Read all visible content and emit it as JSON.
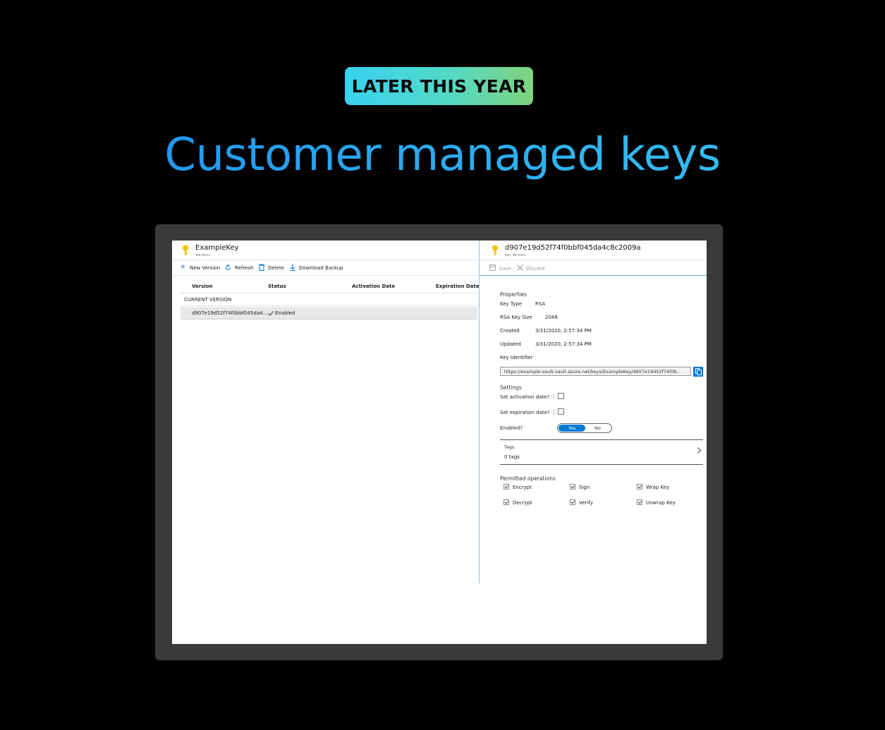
{
  "badge": "LATER THIS YEAR",
  "headline": "Customer managed keys",
  "colors": {
    "accent": "#0078d4",
    "key_icon": "#f5c400",
    "headline_start": "#1e8ef0",
    "headline_end": "#38c7f2"
  },
  "left_blade": {
    "title": "ExampleKey",
    "subtitle": "Versions",
    "icon": "key-icon",
    "toolbar": [
      {
        "icon": "plus-icon",
        "label": "New Version"
      },
      {
        "icon": "refresh-icon",
        "label": "Refresh"
      },
      {
        "icon": "trash-icon",
        "label": "Delete"
      },
      {
        "icon": "download-icon",
        "label": "Download Backup"
      }
    ],
    "columns": [
      "Version",
      "Status",
      "Activation Date",
      "Expiration Date"
    ],
    "group_label": "CURRENT VERSION",
    "rows": [
      {
        "version": "d907e19d52f74f0bbf045da4...",
        "status": "Enabled",
        "activation": "",
        "expiration": ""
      }
    ]
  },
  "right_blade": {
    "title": "d907e19d52f74f0bbf045da4c8c2009a",
    "subtitle": "Key Version",
    "icon": "key-icon",
    "toolbar": [
      {
        "icon": "save-icon",
        "label": "Save"
      },
      {
        "icon": "close-icon",
        "label": "Discard"
      }
    ],
    "properties_header": "Properties",
    "properties": [
      {
        "label": "Key Type",
        "value": "RSA"
      },
      {
        "label": "RSA Key Size",
        "value": "2048"
      },
      {
        "label": "Created",
        "value": "3/31/2020, 2:57:34 PM"
      },
      {
        "label": "Updated",
        "value": "3/31/2020, 2:57:34 PM"
      }
    ],
    "key_identifier_label": "Key Identifier",
    "key_identifier_value": "https://example-vault.vault.azure.net/keys/ExampleKey/d907e19d52f74f0b...",
    "settings_header": "Settings",
    "set_activation_label": "Set activation date?",
    "set_expiration_label": "Set expiration date?",
    "enabled_label": "Enabled?",
    "toggle_yes": "Yes",
    "toggle_no": "No",
    "toggle_selected": "Yes",
    "tags_label": "Tags",
    "tags_value": "0 tags",
    "permitted_header": "Permitted operations",
    "operations": [
      {
        "label": "Encrypt",
        "checked": true
      },
      {
        "label": "Sign",
        "checked": true
      },
      {
        "label": "Wrap Key",
        "checked": true
      },
      {
        "label": "Decrypt",
        "checked": true
      },
      {
        "label": "Verify",
        "checked": true
      },
      {
        "label": "Unwrap Key",
        "checked": true
      }
    ]
  }
}
